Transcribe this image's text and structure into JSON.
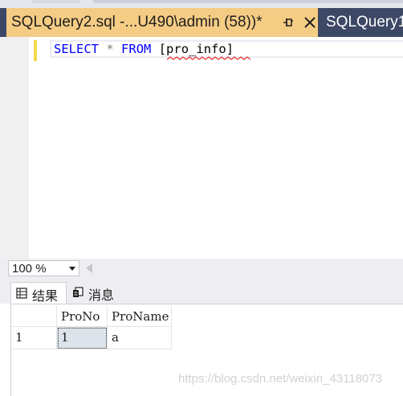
{
  "tabs": {
    "active_title": "SQLQuery2.sql -...U490\\admin (58))*",
    "inactive_title": "SQLQuery1"
  },
  "editor": {
    "keyword_select": "SELECT",
    "operator_star": "*",
    "keyword_from": "FROM",
    "table_identifier": "[pro_info]"
  },
  "zoom": {
    "value": "100 %"
  },
  "results_tabs": [
    {
      "label": "结果",
      "icon": "grid-icon",
      "selected": true
    },
    {
      "label": "消息",
      "icon": "messages-icon",
      "selected": false
    }
  ],
  "grid": {
    "columns": [
      "ProNo",
      "ProName"
    ],
    "rows": [
      {
        "row_number": "1",
        "cells": [
          "1",
          "a"
        ]
      }
    ]
  },
  "watermark": "https://blog.csdn.net/weixin_43118073",
  "colors": {
    "tab_active": "#f5cc84",
    "tab_bar": "#3c4866",
    "keyword": "#0000ff",
    "operator": "#808080",
    "squiggle": "#e03030"
  }
}
